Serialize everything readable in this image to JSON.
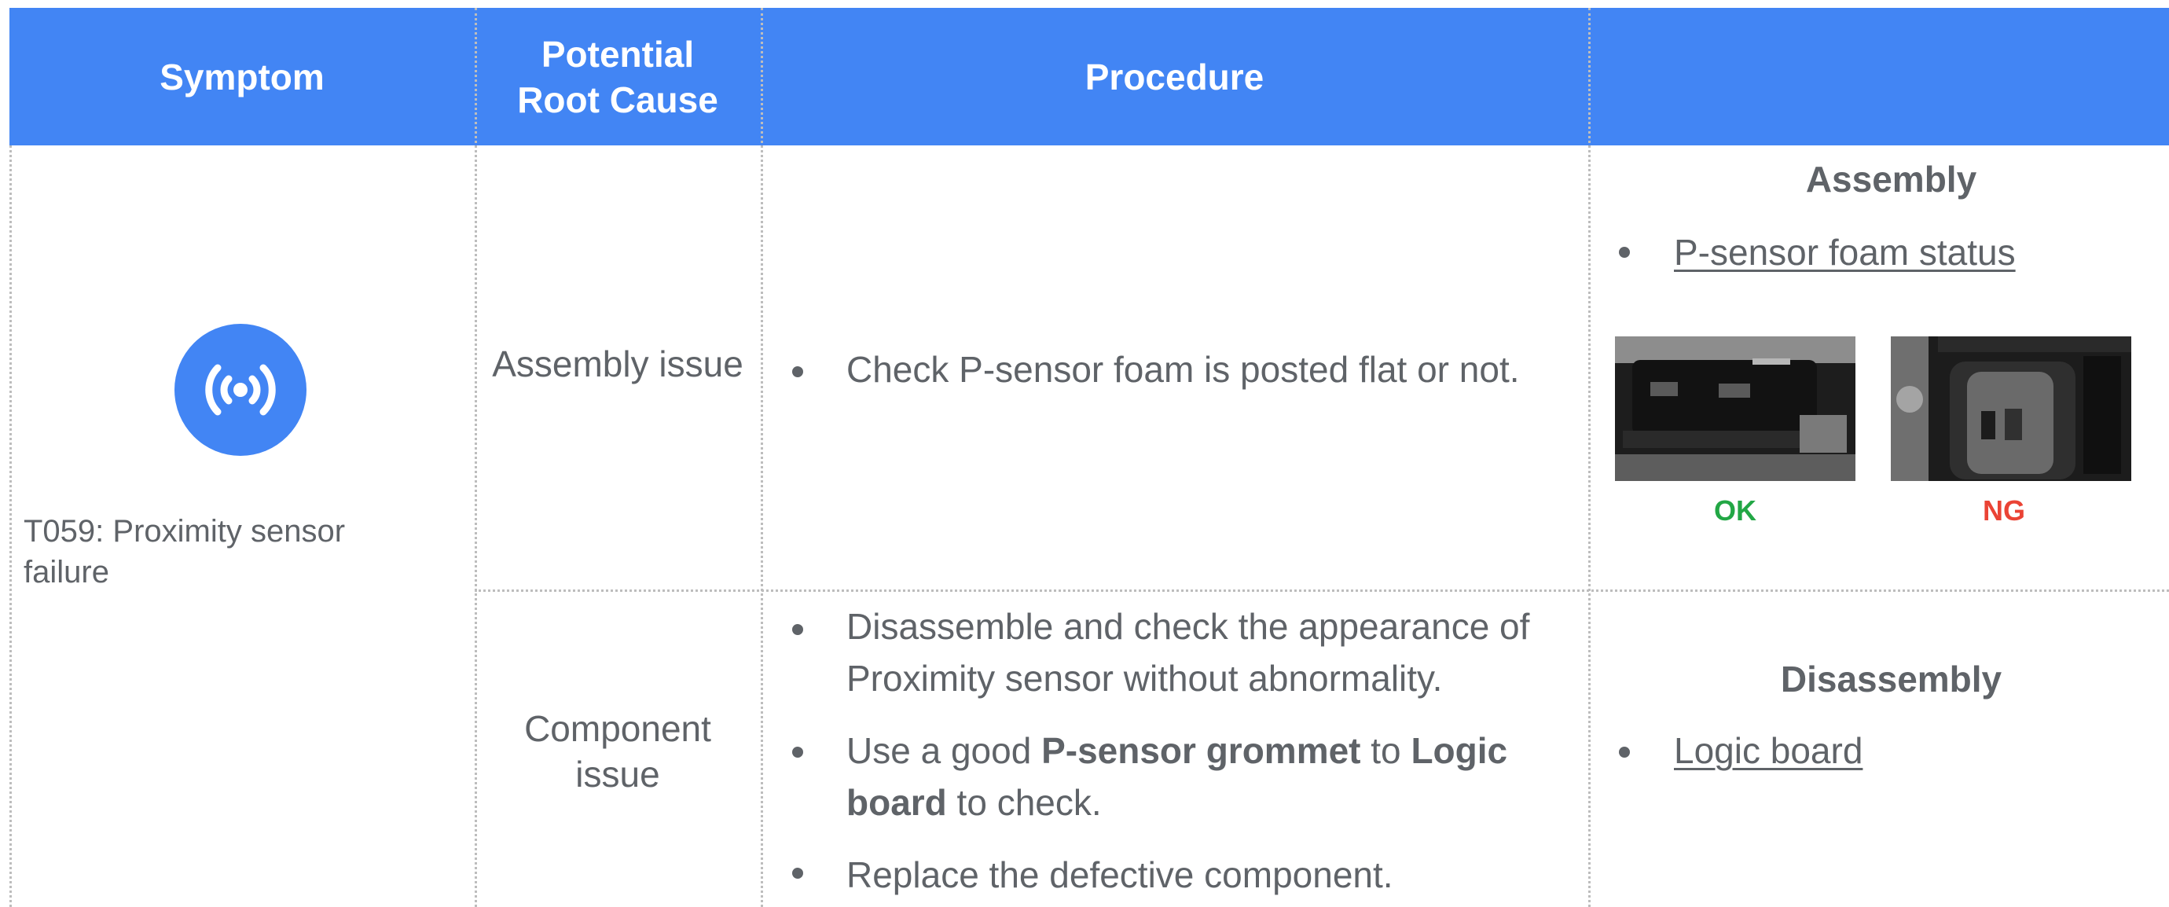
{
  "header": {
    "symptom": "Symptom",
    "potential_root_cause_line1": "Potential",
    "potential_root_cause_line2": "Root Cause",
    "procedure": "Procedure",
    "extra": ""
  },
  "row": {
    "symptom": {
      "icon": "wireless-icon",
      "text_line1": "T059: Proximity sensor",
      "text_line2": "failure"
    },
    "causes": [
      {
        "label": "Assembly issue",
        "procedure_items": [
          "Check P-sensor foam is posted flat or not."
        ],
        "reference": {
          "title": "Assembly",
          "links": [
            "P-sensor foam status"
          ],
          "images": [
            {
              "label": "OK",
              "status_color": "#22a745"
            },
            {
              "label": "NG",
              "status_color": "#ea4335"
            }
          ]
        }
      },
      {
        "label_line1": "Component",
        "label_line2": "issue",
        "procedure_items": [
          {
            "line1": "Disassemble and check the appearance of",
            "line2": "Proximity sensor without abnormality."
          },
          {
            "prefix": "Use a good ",
            "bold1": "P-sensor grommet",
            "middle": " to ",
            "bold2": "Logic",
            "line2_bold": "board",
            "line2_suffix": " to check."
          },
          {
            "text": "Replace the defective component."
          }
        ],
        "reference": {
          "title": "Disassembly",
          "links": [
            "Logic board"
          ]
        }
      }
    ]
  },
  "colors": {
    "header_bg": "#4285f4",
    "text_primary": "#5f6368",
    "grid": "#bdbdbd",
    "ok": "#22a745",
    "ng": "#ea4335"
  }
}
